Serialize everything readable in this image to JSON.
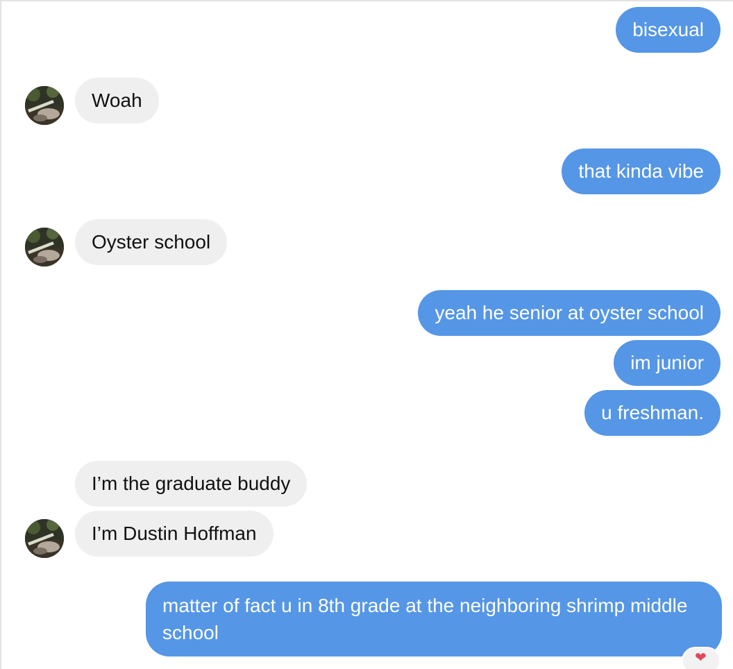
{
  "messages": [
    {
      "from": "me",
      "text": "bisexual"
    },
    {
      "from": "them",
      "text": "Woah"
    },
    {
      "from": "me",
      "text": "that kinda vibe"
    },
    {
      "from": "them",
      "text": "Oyster school"
    },
    {
      "from": "me",
      "text": "yeah he senior at oyster school"
    },
    {
      "from": "me",
      "text": "im junior"
    },
    {
      "from": "me",
      "text": "u freshman."
    },
    {
      "from": "them",
      "text": "I’m the graduate buddy"
    },
    {
      "from": "them",
      "text": "I’m Dustin Hoffman"
    },
    {
      "from": "me",
      "text": "matter of fact u in 8th grade at the neighboring shrimp middle school"
    }
  ],
  "reaction": {
    "icon": "heart-icon",
    "glyph": "❤"
  },
  "colors": {
    "outgoing": "#5596e6",
    "incoming": "#efefef"
  }
}
